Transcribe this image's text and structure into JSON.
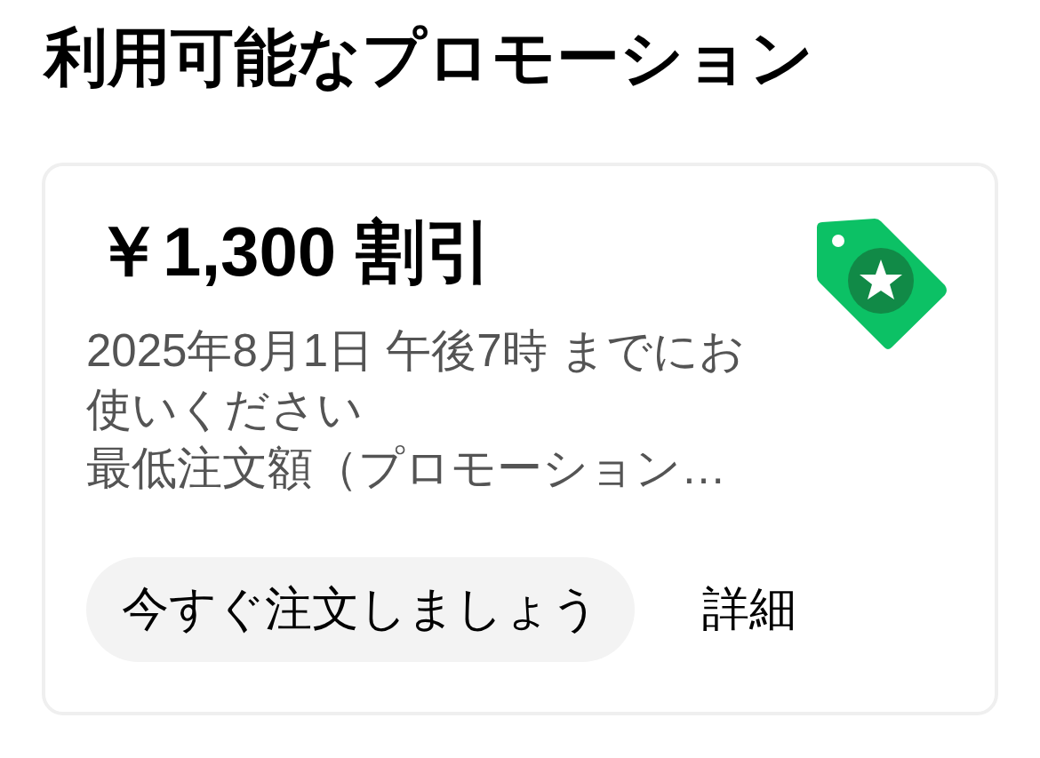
{
  "heading": "利用可能なプロモーション",
  "promotion": {
    "title": "￥1,300 割引",
    "description": [
      "2025年8月1日 午後7時 までにお使いください",
      "最低注文額（プロモーション…"
    ],
    "actions": [
      {
        "label": "今すぐ注文しましょう",
        "kind": "pill"
      },
      {
        "label": "詳細",
        "kind": "link"
      }
    ]
  }
}
